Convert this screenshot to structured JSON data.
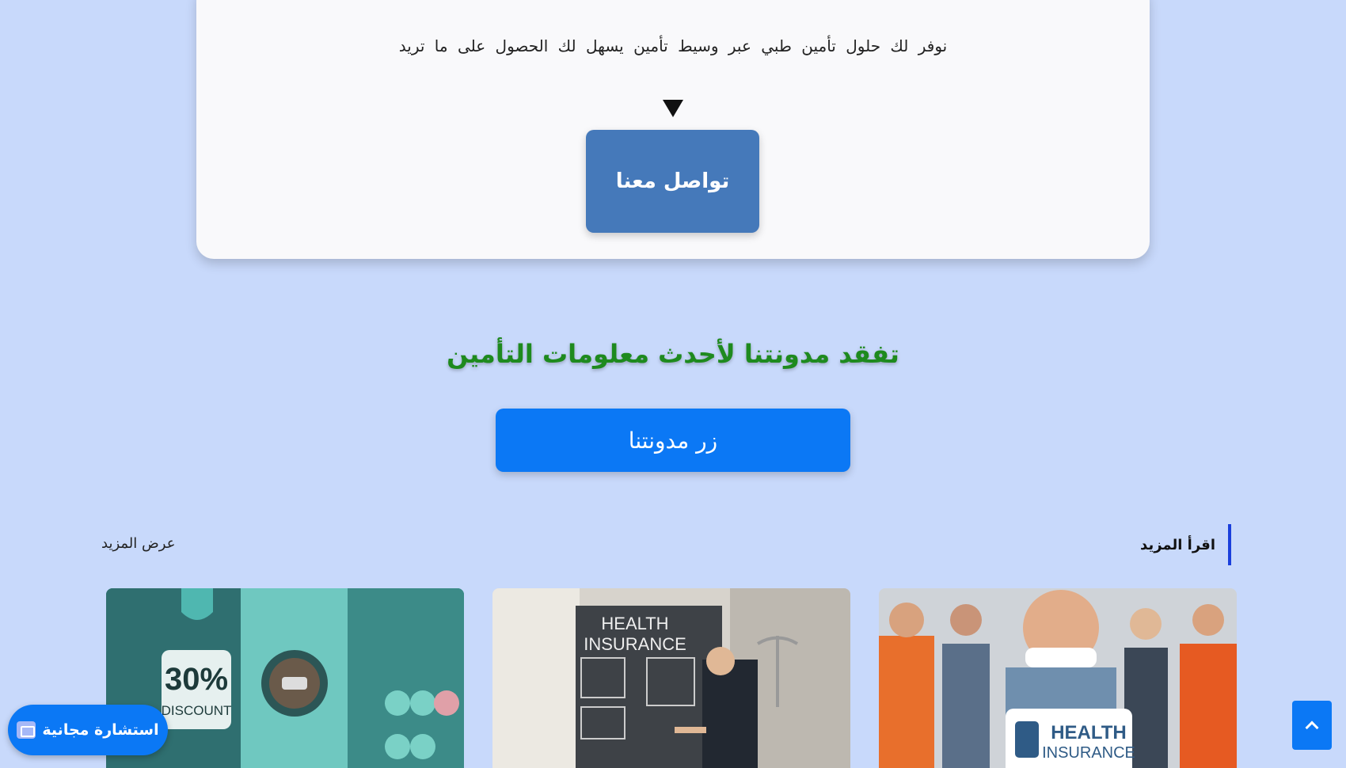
{
  "hero": {
    "text": "نوفر لك حلول تأمين طبي عبر وسيط تأمين يسهل لك الحصول على ما تريد",
    "contact_label": "تواصل معنا"
  },
  "blog": {
    "heading": "تفقد مدونتنا لأحدث معلومات التأمين",
    "button_label": "زر مدونتنا"
  },
  "posts": {
    "section_title": "اقرأ المزيد",
    "view_more": "عرض المزيد",
    "thumbs": [
      {
        "caption_lines": [
          "HEALTH",
          "INSURANCE"
        ],
        "theme": "workers"
      },
      {
        "caption_lines": [
          "HEALTH",
          "INSURANCE"
        ],
        "theme": "presentation"
      },
      {
        "caption_lines": [
          "30%",
          "DISCOUNT"
        ],
        "theme": "discount"
      }
    ]
  },
  "consult": {
    "label": "استشارة مجانية",
    "icon": "mail-icon"
  },
  "scroll_top": {
    "icon": "chevron-up-icon"
  },
  "colors": {
    "background": "#c8d9fb",
    "contact_button": "#4579ba",
    "primary_button": "#0b78f5",
    "heading_green": "#1e8a1e",
    "accent_border": "#1a3fdc"
  }
}
